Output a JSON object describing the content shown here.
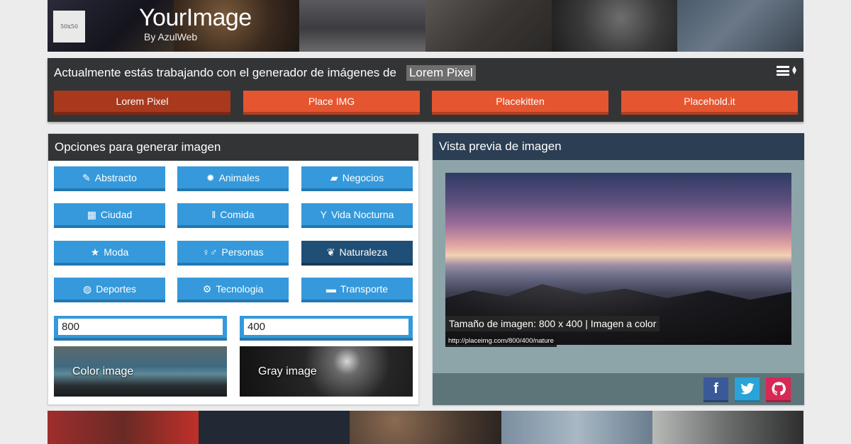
{
  "header": {
    "logo_text": "50x50",
    "brand": "YourImage",
    "brand_sub": "By AzulWeb"
  },
  "generator": {
    "title": "Actualmente estás trabajando con el generador de imágenes de",
    "current": "Lorem Pixel",
    "menu_icon": "list-sort-icon",
    "buttons": [
      {
        "label": "Lorem Pixel",
        "active": true
      },
      {
        "label": "Place IMG",
        "active": false
      },
      {
        "label": "Placekitten",
        "active": false
      },
      {
        "label": "Placehold.it",
        "active": false
      }
    ]
  },
  "options": {
    "title": "Opciones para generar imagen",
    "categories": [
      {
        "label": "Abstracto",
        "icon": "feather-icon",
        "active": false
      },
      {
        "label": "Animales",
        "icon": "bug-icon",
        "active": false
      },
      {
        "label": "Negocios",
        "icon": "briefcase-icon",
        "active": false
      },
      {
        "label": "Ciudad",
        "icon": "building-icon",
        "active": false
      },
      {
        "label": "Comida",
        "icon": "cutlery-icon",
        "active": false
      },
      {
        "label": "Vida Nocturna",
        "icon": "glass-icon",
        "active": false
      },
      {
        "label": "Moda",
        "icon": "star-icon",
        "active": false
      },
      {
        "label": "Personas",
        "icon": "people-icon",
        "active": false
      },
      {
        "label": "Naturaleza",
        "icon": "leaf-icon",
        "active": true
      },
      {
        "label": "Deportes",
        "icon": "basketball-icon",
        "active": false
      },
      {
        "label": "Tecnologia",
        "icon": "gears-icon",
        "active": false
      },
      {
        "label": "Transporte",
        "icon": "truck-icon",
        "active": false
      }
    ],
    "width_value": "800",
    "height_value": "400",
    "color_label": "Color image",
    "gray_label": "Gray image"
  },
  "preview": {
    "title": "Vista previa de imagen",
    "caption": "Tamaño de imagen: 800 x 400 | Imagen a color",
    "url": "http://placeimg.com/800/400/nature",
    "social": [
      {
        "name": "facebook-icon",
        "glyph": "f"
      },
      {
        "name": "twitter-icon",
        "glyph": "t"
      },
      {
        "name": "github-icon",
        "glyph": "g"
      }
    ]
  }
}
